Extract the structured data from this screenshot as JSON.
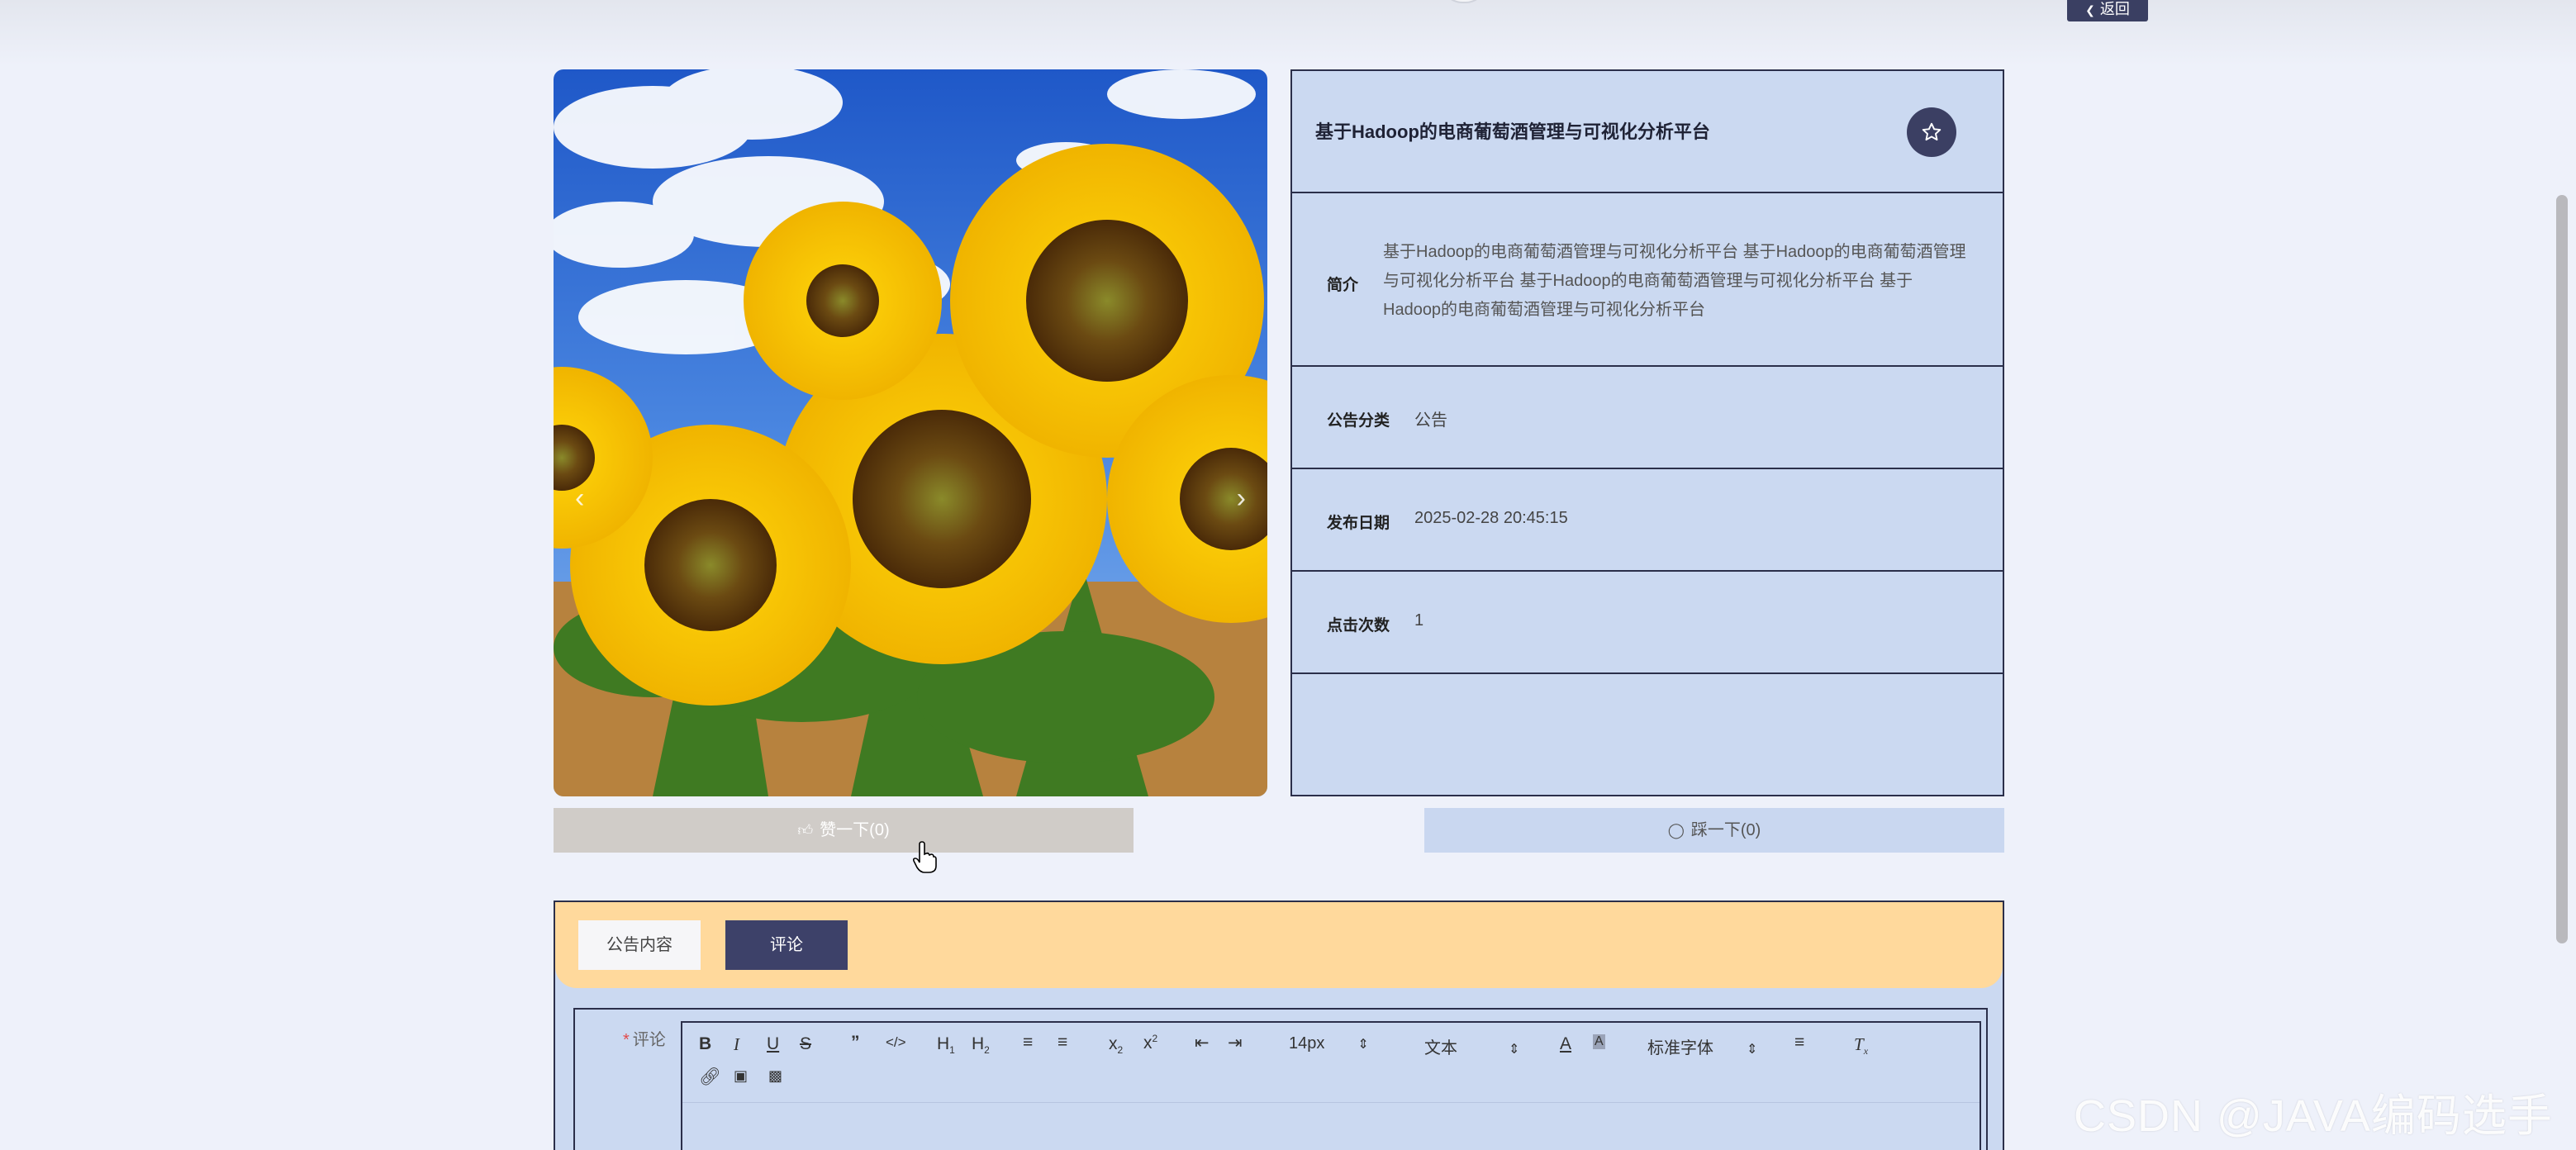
{
  "header": {
    "back_label": "返回"
  },
  "notice": {
    "title": "基于Hadoop的电商葡萄酒管理与可视化分析平台",
    "intro_label": "简介",
    "intro_text": "基于Hadoop的电商葡萄酒管理与可视化分析平台 基于Hadoop的电商葡萄酒管理与可视化分析平台 基于Hadoop的电商葡萄酒管理与可视化分析平台 基于Hadoop的电商葡萄酒管理与可视化分析平台",
    "category_label": "公告分类",
    "category_value": "公告",
    "date_label": "发布日期",
    "date_value": "2025-02-28 20:45:15",
    "clicks_label": "点击次数",
    "clicks_value": "1"
  },
  "actions": {
    "like_label": "赞一下(0)",
    "dislike_label": "踩一下(0)"
  },
  "tabs": [
    {
      "label": "公告内容",
      "active": false
    },
    {
      "label": "评论",
      "active": true
    }
  ],
  "comment": {
    "label": "评论",
    "font_size": "14px",
    "text_type": "文本",
    "font_family": "标准字体"
  },
  "watermark": "CSDN @JAVA编码选手",
  "colors": {
    "accent": "#3d4169",
    "panel": "#cbd9f1",
    "tab_bar": "#ffd99c",
    "like_btn": "#d0ccc8"
  }
}
